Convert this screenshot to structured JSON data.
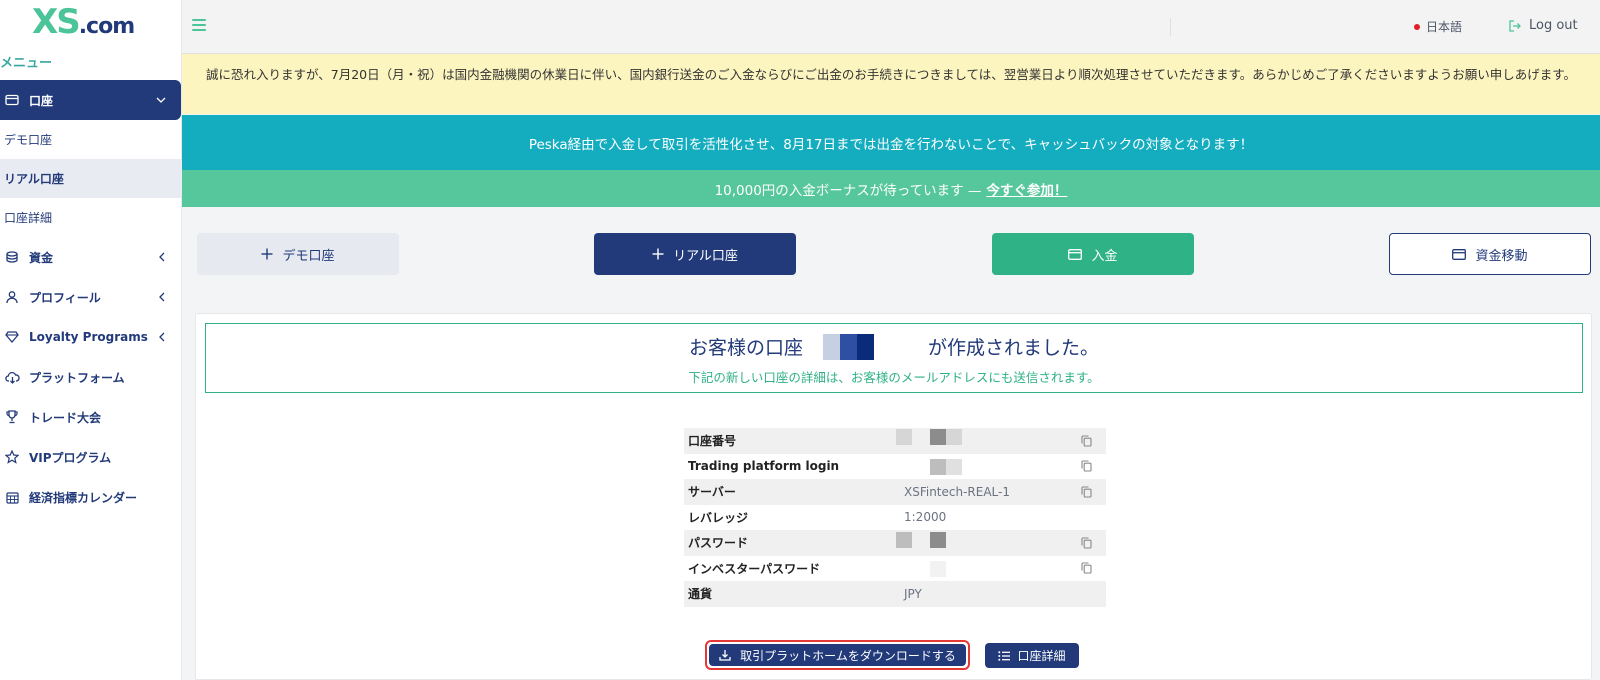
{
  "brand": {
    "logo_xs": "XS",
    "logo_com": ".com"
  },
  "sidebar": {
    "menu_title": "メニュー",
    "items": [
      {
        "label": "口座",
        "icon": "wallet-icon"
      },
      {
        "label": "資金",
        "icon": "coins-icon"
      },
      {
        "label": "プロフィール",
        "icon": "user-icon"
      },
      {
        "label": "Loyalty Programs",
        "icon": "diamond-icon"
      },
      {
        "label": "プラットフォーム",
        "icon": "cloud-download-icon"
      },
      {
        "label": "トレード大会",
        "icon": "trophy-icon"
      },
      {
        "label": "VIPプログラム",
        "icon": "star-icon"
      },
      {
        "label": "経済指標カレンダー",
        "icon": "calendar-icon"
      }
    ],
    "subitems": [
      {
        "label": "デモ口座"
      },
      {
        "label": "リアル口座"
      },
      {
        "label": "口座詳細"
      }
    ]
  },
  "header": {
    "language": "日本語",
    "logout": "Log out"
  },
  "banners": {
    "notice": "誠に恐れ入りますが、7月20日（月・祝）は国内金融機関の休業日に伴い、国内銀行送金のご入金ならびにご出金のお手続きにつきましては、翌営業日より順次処理させていただきます。あらかじめご了承くださいますようお願い申しあげます。",
    "peska": "Peska経由で入金して取引を活性化させ、8月17日までは出金を行わないことで、キャッシュバックの対象となります！",
    "bonus_text": "10,000円の入金ボーナスが待っています —",
    "bonus_link": "今すぐ参加！"
  },
  "actions": {
    "demo": "デモ口座",
    "real": "リアル口座",
    "deposit": "入金",
    "transfer": "資金移動"
  },
  "success": {
    "title_pre": "お客様の口座",
    "title_post": "が作成されました。",
    "subtitle": "下記の新しい口座の詳細は、お客様のメールアドレスにも送信されます。"
  },
  "details": [
    {
      "label": "口座番号",
      "value": "",
      "copy": true
    },
    {
      "label": "Trading platform login",
      "value": "",
      "copy": true
    },
    {
      "label": "サーバー",
      "value": "XSFintech-REAL-1",
      "copy": true
    },
    {
      "label": "レバレッジ",
      "value": "1:2000",
      "copy": false
    },
    {
      "label": "パスワード",
      "value": "",
      "copy": true
    },
    {
      "label": "インベスターパスワード",
      "value": "",
      "copy": true
    },
    {
      "label": "通貨",
      "value": "JPY",
      "copy": false
    }
  ],
  "buttons": {
    "download": "取引プラットホームをダウンロードする",
    "account_details": "口座詳細"
  },
  "colors": {
    "navy": "#223a7a",
    "green": "#2fb285",
    "teal": "#14adc0",
    "light_green": "#56c79c",
    "yellow": "#fdf5c0",
    "highlight_red": "#e53935"
  }
}
